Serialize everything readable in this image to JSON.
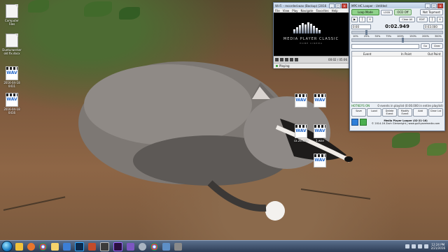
{
  "desktop_icons": [
    {
      "label": "Computer Files",
      "kind": "file"
    },
    {
      "label": "Dueturwerker old fix.docx",
      "kind": "file"
    },
    {
      "label": "2016-04-18 0411",
      "kind": "wav"
    },
    {
      "label": "2016-04-18 0416",
      "kind": "wav"
    },
    {
      "label": "",
      "kind": "wav"
    },
    {
      "label": "",
      "kind": "wav"
    },
    {
      "label": "ca.28.wav",
      "kind": "wav"
    },
    {
      "label": "1.wav",
      "kind": "wav"
    },
    {
      "label": "",
      "kind": "wav"
    }
  ],
  "mpc": {
    "title": "Wi-Fi – recorded.wav (Backup) [2016",
    "menu": [
      "File",
      "View",
      "Play",
      "Navigate",
      "Favorites",
      "Help"
    ],
    "logo_title": "MEDIA PLAYER CLASSIC",
    "logo_sub": "HOME CINEMA",
    "time": "00:02 / 05:06",
    "status": "Playing"
  },
  "looper": {
    "title": "MPC-HC Looper - Untitled",
    "loop_mode": "Loop Mode",
    "lock": "LOCK",
    "ocd_off": "OCD Off",
    "not_topmost": "Not Topmost",
    "clear_all": "Clear All",
    "edit": "EDIT",
    "set": "SET",
    "time_display": "0:02.949",
    "in_time": "0:00",
    "out_time": "0:03.000",
    "percentages": [
      "10%",
      "25%",
      "50%",
      "75%",
      "100%",
      "150%",
      "200%",
      "300%"
    ],
    "go": "Go",
    "clear": "Clear",
    "columns": [
      "Event",
      "In Point",
      "Out Point"
    ],
    "hotkeys": "HOTKEYS ON",
    "events_info": "0 events in playlist (0:00.000 in entire playlist)",
    "buttons": [
      "Save",
      "Load",
      "Delete Event",
      "Modify Event",
      "Add",
      "Clear Lst"
    ],
    "about_title": "Media Player Looper (02-21-16)",
    "about_copy": "© 2014-16 Zach Glenwright | www.guiltyseemedia.com"
  },
  "taskbar": {
    "apps": [
      "explorer",
      "firefox",
      "chrome",
      "folder",
      "media",
      "photoshop",
      "video",
      "mpc",
      "premiere",
      "app",
      "settings",
      "chrome2",
      "misc",
      "misc2"
    ],
    "time": "12:24 PM",
    "date": "2/21/2016"
  },
  "colors": {
    "taskbar": "#2c3c55",
    "loop_green": "#8fd18a",
    "hotkeys": "#1c7a1c"
  }
}
